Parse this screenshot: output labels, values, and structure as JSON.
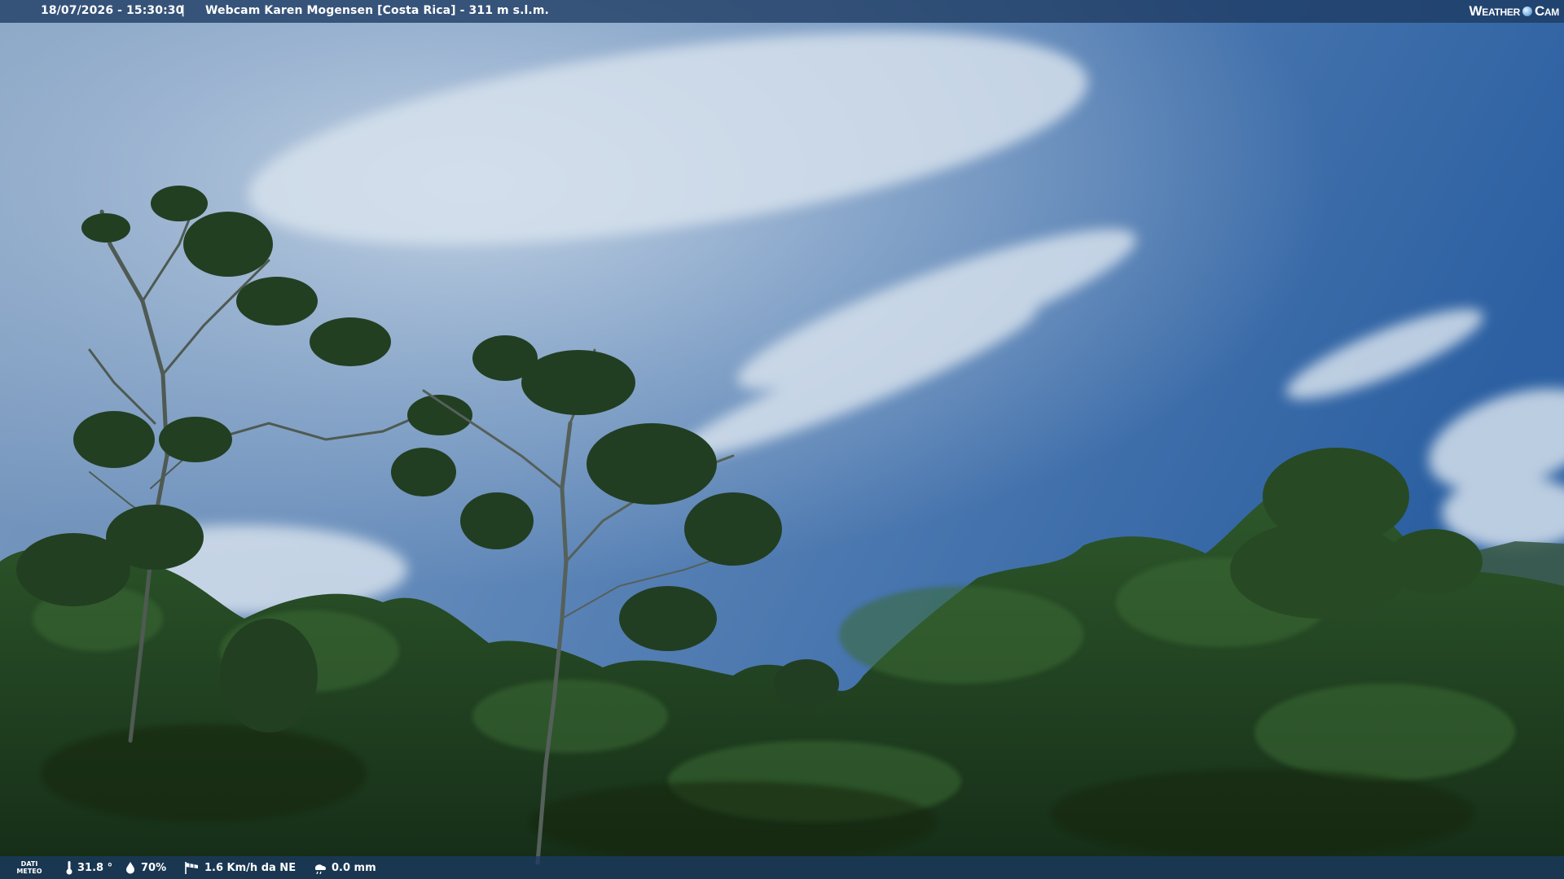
{
  "header": {
    "datetime": "18/07/2026 - 15:30:30",
    "separator": "|",
    "title": "Webcam Karen Mogensen [Costa Rica]  - 311 m s.l.m.",
    "logo": {
      "word1": "Weather",
      "word2": "Cam"
    }
  },
  "footer": {
    "dati_line1": "DATI",
    "dati_line2": "METEO",
    "temperature": "31.8 °",
    "humidity": "70%",
    "wind": "1.6 Km/h da NE",
    "rain": "0.0 mm",
    "icons": [
      "thermometer-icon",
      "humidity-drop-icon",
      "wind-windsock-icon",
      "rain-gauge-icon"
    ]
  },
  "colors": {
    "sky_top": "#5b83b4",
    "sky_right": "#2f63a3",
    "cloud": "#cfdbe8",
    "canopy_dark": "#1e3a1c",
    "canopy_mid": "#2f5a2a",
    "overlay_bar": "#1c3a62"
  }
}
